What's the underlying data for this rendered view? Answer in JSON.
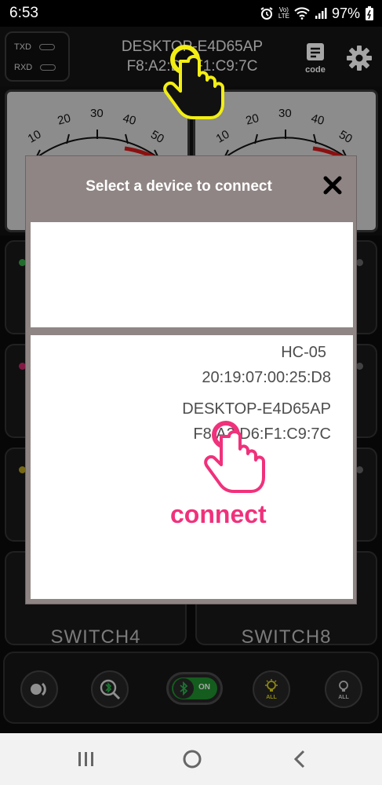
{
  "status_bar": {
    "time": "6:53",
    "lte_top": "Vo)",
    "lte_bottom": "LTE",
    "battery": "97%"
  },
  "top_bar": {
    "txd_label": "TXD",
    "rxd_label": "RXD",
    "device_name": "DESKTOP-E4D65AP",
    "device_mac": "F8:A2:D6:F1:C9:7C",
    "code_label": "code"
  },
  "meters": {
    "scale_labels": [
      "10",
      "20",
      "30",
      "40",
      "50"
    ]
  },
  "switches": {
    "left_bottom_label": "SWITCH4",
    "right_bottom_label": "SWITCH8"
  },
  "bottom_controls": {
    "toggle_label": "ON",
    "bulb_on_label": "ALL",
    "bulb_off_label": "ALL"
  },
  "dialog": {
    "title": "Select a device to connect",
    "devices": [
      {
        "name": "HC-05",
        "mac": "20:19:07:00:25:D8"
      },
      {
        "name": "DESKTOP-E4D65AP",
        "mac": "F8:A2:D6:F1:C9:7C"
      }
    ],
    "annotation": "connect"
  },
  "colors": {
    "accent_pink": "#f0317b",
    "hand_yellow": "#f2ee14",
    "toggle_green": "#1f8f2e"
  }
}
